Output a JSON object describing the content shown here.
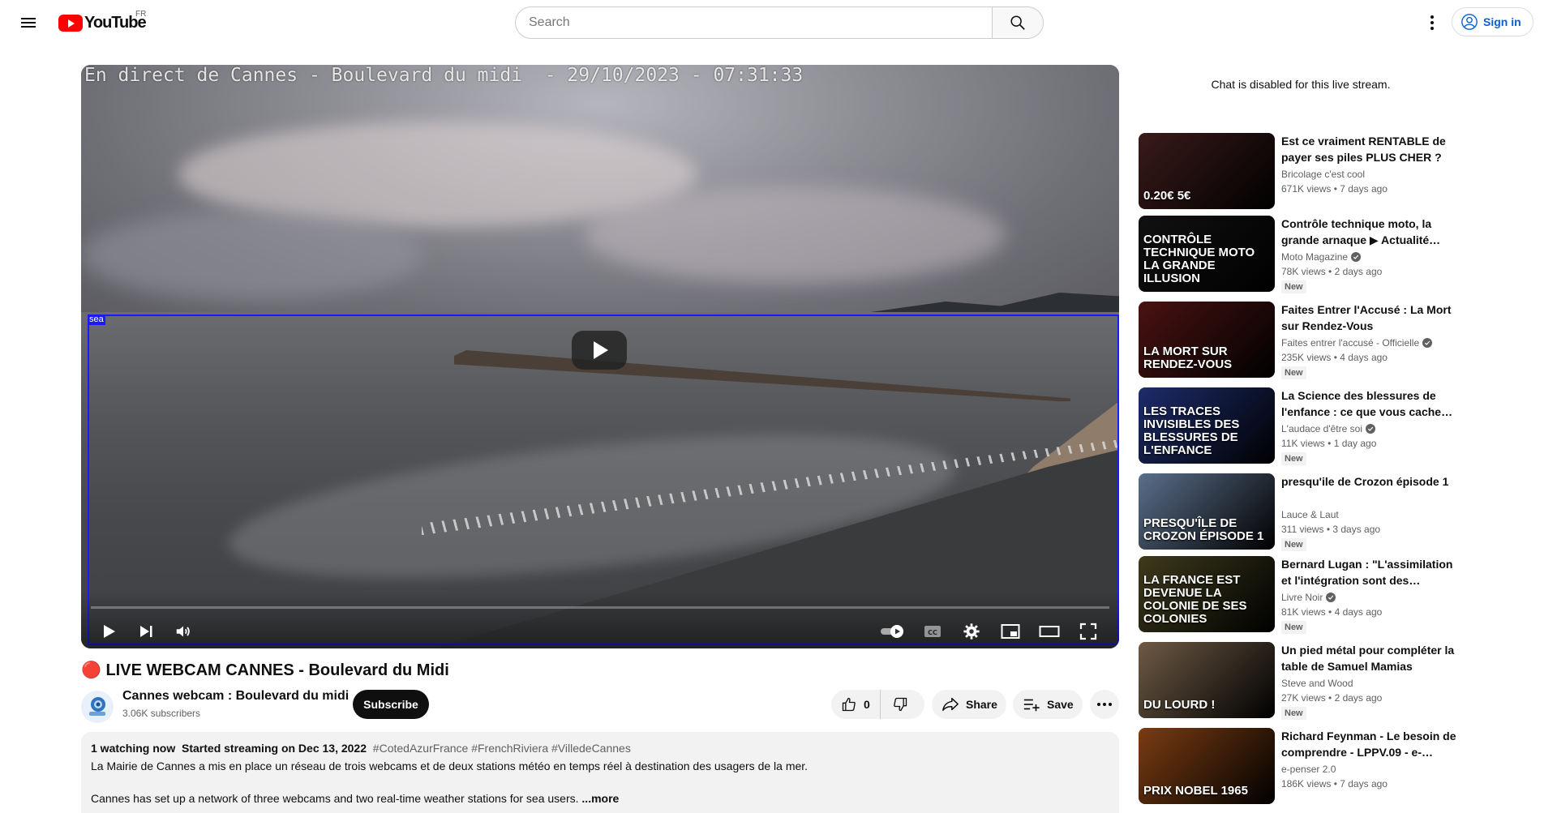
{
  "header": {
    "logo_text": "YouTube",
    "country_code": "FR",
    "search_placeholder": "Search",
    "signin_label": "Sign in"
  },
  "player": {
    "overlay_text": "En direct de Cannes - Boulevard du midi  - 29/10/2023 - 07:31:33",
    "detection_label": "sea"
  },
  "video": {
    "title": "🔴 LIVE WEBCAM CANNES - Boulevard du Midi",
    "channel_name": "Cannes webcam : Boulevard du midi",
    "subscribers": "3.06K subscribers",
    "subscribe_label": "Subscribe",
    "like_count": "0",
    "share_label": "Share",
    "save_label": "Save"
  },
  "description": {
    "watching": "1 watching now",
    "started": "Started streaming on Dec 13, 2022",
    "tags": "#CotedAzurFrance #FrenchRiviera #VilledeCannes",
    "line1": "La Mairie de Cannes a mis en place un réseau de trois webcams et de deux stations météo en temps réel à destination des usagers de la mer.",
    "line2": "Cannes has set up a network of three webcams and two real-time weather stations for sea users.",
    "more_label": "...more"
  },
  "sidebar": {
    "chat_disabled": "Chat is disabled for this live stream.",
    "recommendations": [
      {
        "title": "Est ce vraiment RENTABLE de payer ses piles PLUS CHER ?",
        "channel": "Bricolage c'est cool",
        "verified": false,
        "views": "671K views",
        "age": "7 days ago",
        "badge": "",
        "thumb_text": "0.20€  5€",
        "thumb_color": "#3a1a1a"
      },
      {
        "title": "Contrôle technique moto, la grande arnaque ▶ Actualité…",
        "channel": "Moto Magazine",
        "verified": true,
        "views": "78K views",
        "age": "2 days ago",
        "badge": "New",
        "thumb_text": "CONTRÔLE TECHNIQUE MOTO La grande illusion",
        "thumb_color": "#111111"
      },
      {
        "title": "Faites Entrer l'Accusé : La Mort sur Rendez-Vous",
        "channel": "Faites entrer l'accusé - Officielle",
        "verified": true,
        "views": "235K views",
        "age": "4 days ago",
        "badge": "New",
        "thumb_text": "LA MORT SUR RENDEZ-VOUS",
        "thumb_color": "#4a1212"
      },
      {
        "title": "La Science des blessures de l'enfance : ce que vous cache…",
        "channel": "L'audace d'être soi",
        "verified": true,
        "views": "11K views",
        "age": "1 day ago",
        "badge": "New",
        "thumb_text": "LES TRACES INVISIBLES DES BLESSURES DE L'ENFANCE",
        "thumb_color": "#1d2c6b"
      },
      {
        "title": "presqu'ile de Crozon épisode 1",
        "channel": "Lauce & Laut",
        "verified": false,
        "views": "311 views",
        "age": "3 days ago",
        "badge": "New",
        "thumb_text": "Presqu'île de crozon épisode 1",
        "thumb_color": "#5a6f8a"
      },
      {
        "title": "Bernard Lugan : \"L'assimilation et l'intégration sont des…",
        "channel": "Livre Noir",
        "verified": true,
        "views": "81K views",
        "age": "4 days ago",
        "badge": "New",
        "thumb_text": "LA FRANCE EST DEVENUE LA COLONIE DE SES COLONIES",
        "thumb_color": "#3d3a1c"
      },
      {
        "title": "Un pied métal pour compléter la table de Samuel Mamias",
        "channel": "Steve and Wood",
        "verified": false,
        "views": "27K views",
        "age": "2 days ago",
        "badge": "New",
        "thumb_text": "DU LOURD !",
        "thumb_color": "#6e5a45"
      },
      {
        "title": "Richard Feynman - Le besoin de comprendre - LPPV.09 - e-…",
        "channel": "e-penser 2.0",
        "verified": false,
        "views": "186K views",
        "age": "7 days ago",
        "badge": "",
        "thumb_text": "PRIX NOBEL 1965",
        "thumb_color": "#7a3c12"
      }
    ]
  }
}
